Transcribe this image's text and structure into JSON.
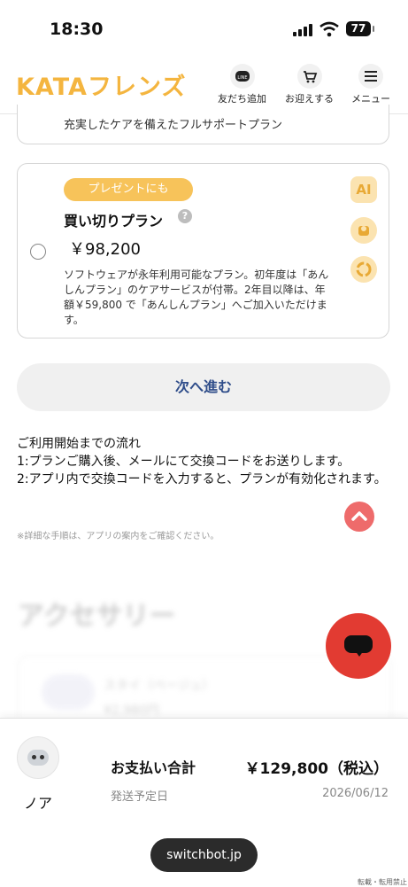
{
  "status_bar": {
    "time": "18:30",
    "battery": "77"
  },
  "header": {
    "logo": "KATAフレンズ",
    "nav": [
      {
        "label": "友だち追加",
        "icon": "line-icon"
      },
      {
        "label": "お迎えする",
        "icon": "cart-icon"
      },
      {
        "label": "メニュー",
        "icon": "menu-icon"
      }
    ]
  },
  "plans": {
    "previous_description": "充実したケアを備えたフルサポートプラン",
    "buyout": {
      "badge": "プレゼントにも",
      "name": "買い切りプラン",
      "help": "?",
      "price": "￥98,200",
      "description": "ソフトウェアが永年利用可能なプラン。初年度は「あんしんプラン」のケアサービスが付帯。2年目以降は、年額￥59,800 で「あんしんプラン」へご加入いただけます。",
      "features": [
        "AI"
      ]
    }
  },
  "next_button": "次へ進む",
  "flow": {
    "title": "ご利用開始までの流れ",
    "step1": "1:プランご購入後、メールにて交換コードをお送りします。",
    "step2": "2:アプリ内で交換コードを入力すると、プランが有効化されます。",
    "note": "※詳細な手順は、アプリの案内をご確認ください。"
  },
  "accessories": {
    "title": "アクセサリー",
    "item_name": "スタイ（ベージュ）",
    "item_price": "¥2,980円"
  },
  "checkout": {
    "product_name": "ノア",
    "total_label": "お支払い合計",
    "total_value": "￥129,800（税込）",
    "ship_label": "発送予定日",
    "ship_date": "2026/06/12"
  },
  "browser": {
    "url": "switchbot.jp"
  },
  "footer": {
    "copyright": "転載・転用禁止"
  },
  "colors": {
    "accent": "#f4b53f",
    "chat": "#e23b32",
    "link": "#2f4d8a"
  }
}
